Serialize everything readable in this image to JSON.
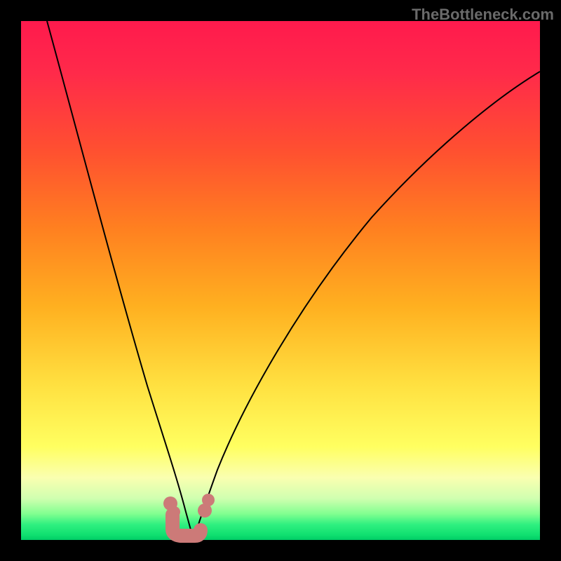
{
  "watermark": "TheBottleneck.com",
  "chart_data": {
    "type": "line",
    "title": "",
    "xlabel": "",
    "ylabel": "",
    "xlim": [
      0,
      100
    ],
    "ylim": [
      0,
      100
    ],
    "background_gradient_stops": [
      {
        "pos": 0,
        "color": "#ff1a4d"
      },
      {
        "pos": 25,
        "color": "#ff5030"
      },
      {
        "pos": 55,
        "color": "#ffb020"
      },
      {
        "pos": 82,
        "color": "#ffff60"
      },
      {
        "pos": 95,
        "color": "#80ff90"
      },
      {
        "pos": 100,
        "color": "#00cc66"
      }
    ],
    "series": [
      {
        "name": "left-branch",
        "x": [
          5,
          8,
          12,
          16,
          20,
          23,
          25,
          27,
          28.5,
          30,
          31.5,
          33
        ],
        "y": [
          100,
          88,
          73,
          58,
          43,
          32,
          24,
          16,
          10,
          5,
          2,
          0
        ]
      },
      {
        "name": "right-branch",
        "x": [
          33,
          35,
          38,
          43,
          50,
          58,
          68,
          80,
          92,
          100
        ],
        "y": [
          0,
          3,
          10,
          22,
          36,
          49,
          62,
          74,
          84,
          90
        ]
      }
    ],
    "markers": [
      {
        "series": "left-branch",
        "x": 29,
        "y": 7,
        "color": "#cc7a78"
      },
      {
        "series": "left-branch",
        "x": 30,
        "y": 5,
        "color": "#cc7a78"
      },
      {
        "series": "right-branch",
        "x": 35.5,
        "y": 6,
        "color": "#cc7a78"
      },
      {
        "series": "right-branch",
        "x": 36,
        "y": 8,
        "color": "#cc7a78"
      }
    ],
    "annotation_u": {
      "description": "salmon U-shaped marker near curve minimum",
      "points_xy": [
        [
          29,
          5
        ],
        [
          29,
          2
        ],
        [
          31,
          1
        ],
        [
          33,
          1
        ],
        [
          34,
          2
        ]
      ],
      "color": "#cc7a78"
    },
    "grid": false,
    "legend": false
  }
}
